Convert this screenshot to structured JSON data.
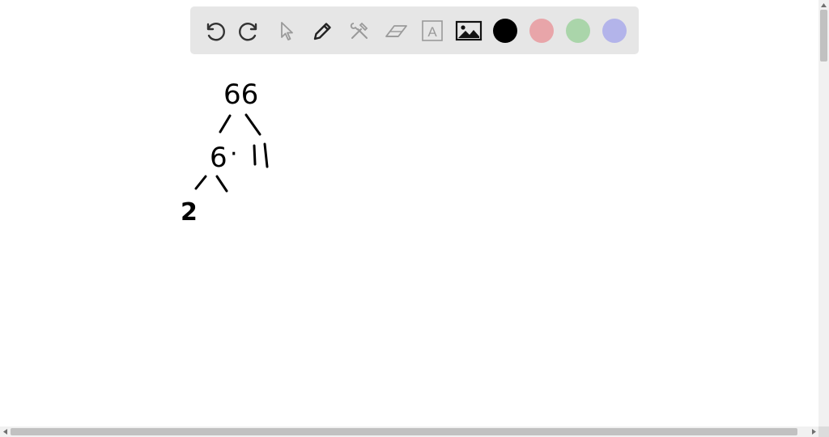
{
  "toolbar": {
    "tools": [
      {
        "name": "undo-icon"
      },
      {
        "name": "redo-icon"
      },
      {
        "name": "pointer-icon"
      },
      {
        "name": "pencil-icon"
      },
      {
        "name": "tools-icon"
      },
      {
        "name": "eraser-icon"
      },
      {
        "name": "text-icon",
        "glyph": "A"
      },
      {
        "name": "image-icon"
      }
    ],
    "colors": {
      "black": "#000000",
      "red": "#e8a5a9",
      "green": "#aad5aa",
      "blue": "#b3b4ea"
    }
  },
  "drawing": {
    "top_number": "66",
    "middle_left": "6",
    "dot": "·",
    "middle_right": "11",
    "bottom_left": "2"
  }
}
